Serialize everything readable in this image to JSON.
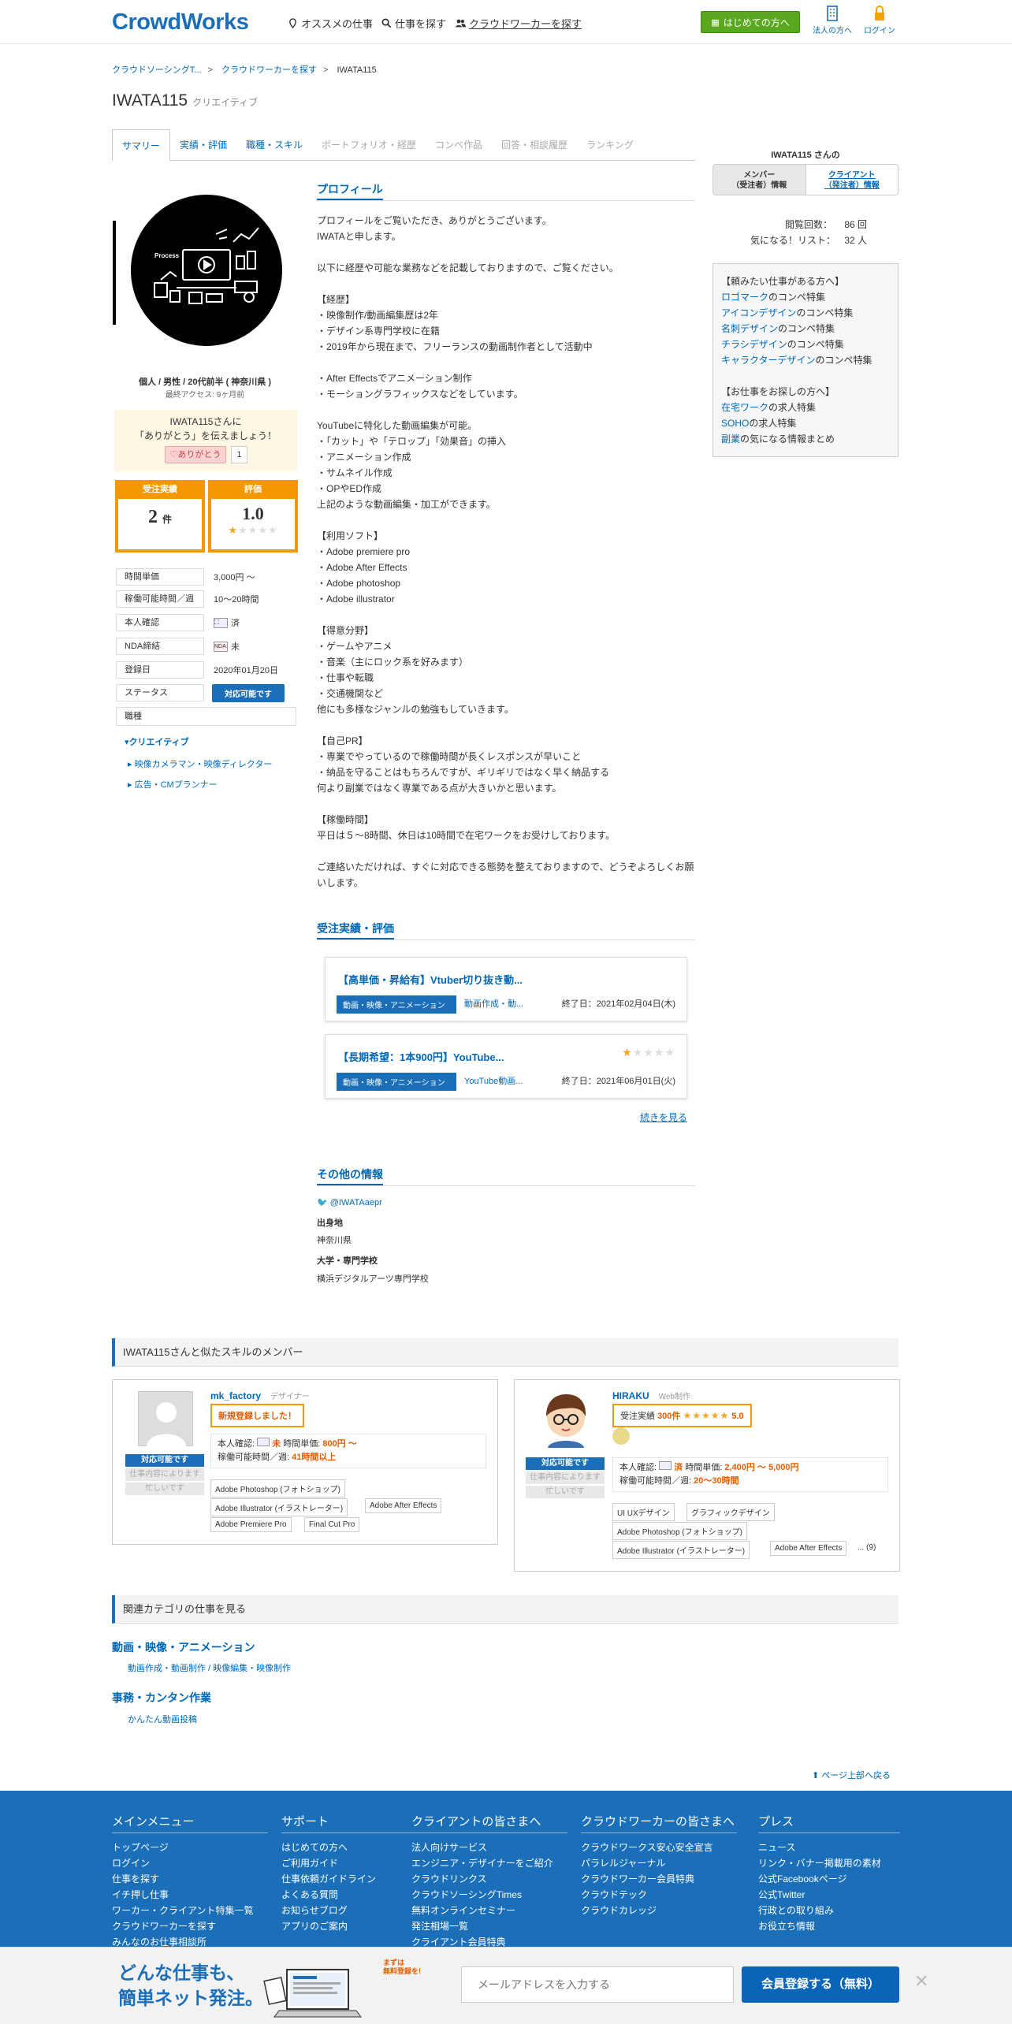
{
  "header": {
    "logo": "CrowdWorks",
    "nav": [
      "オススメの仕事",
      "仕事を探す",
      "クラウドワーカーを探す"
    ],
    "first_btn": "はじめての方へ",
    "corp": "法人の方へ",
    "login": "ログイン"
  },
  "breadcrumb": [
    "クラウドソーシングT...",
    "クラウドワーカーを探す",
    "IWATA115"
  ],
  "profile": {
    "name": "IWATA115",
    "category": "クリエイティブ",
    "tabs": [
      {
        "label": "サマリー",
        "state": "active"
      },
      {
        "label": "実績・評価",
        "state": "link"
      },
      {
        "label": "職種・スキル",
        "state": "link"
      },
      {
        "label": "ポートフォリオ・経歴",
        "state": "disabled"
      },
      {
        "label": "コンペ作品",
        "state": "disabled"
      },
      {
        "label": "回答・相談履歴",
        "state": "disabled"
      },
      {
        "label": "ランキング",
        "state": "disabled"
      }
    ],
    "identity": "個人 / 男性 / 20代前半 ( 神奈川県 )",
    "last_access": "最終アクセス: 9ヶ月前",
    "thanks_line1": "IWATA115さんに",
    "thanks_line2": "「ありがとう」を伝えましょう！",
    "thanks_btn": "ありがとう",
    "thanks_count": "1",
    "orders_label": "受注実績",
    "orders_value": "2",
    "orders_unit": "件",
    "rating_label": "評価",
    "rating_value": "1.0",
    "rating_stars": 1,
    "stats": [
      {
        "key": "時間単価",
        "value": "3,000円 〜"
      },
      {
        "key": "稼働可能時間／週",
        "value": "10〜20時間"
      },
      {
        "key": "本人確認",
        "value": "済"
      },
      {
        "key": "NDA締結",
        "value": "未"
      },
      {
        "key": "登録日",
        "value": "2020年01月20日"
      },
      {
        "key": "ステータス",
        "value": "対応可能です"
      }
    ],
    "job_label": "職種",
    "job_cat": "クリエイティブ",
    "job_subs": [
      "映像カメラマン・映像ディレクター",
      "広告・CMプランナー"
    ]
  },
  "main": {
    "profile_heading": "プロフィール",
    "profile_text": "プロフィールをご覧いただき、ありがとうございます。\nIWATAと申します。\n\n以下に経歴や可能な業務などを記載しておりますので、ご覧ください。\n\n【経歴】\n・映像制作/動画編集歴は2年\n・デザイン系専門学校に在籍\n・2019年から現在まで、フリーランスの動画制作者として活動中\n\n・After Effectsでアニメーション制作\n・モーショングラフィックスなどをしています。\n\nYouTubeに特化した動画編集が可能。\n・「カット」や「テロップ」「効果音」の挿入\n・アニメーション作成\n・サムネイル作成\n・OPやED作成\n上記のような動画編集・加工ができます。\n\n【利用ソフト】\n・Adobe premiere pro\n・Adobe After Effects\n・Adobe photoshop\n・Adobe illustrator\n\n【得意分野】\n・ゲームやアニメ\n・音楽（主にロック系を好みます）\n・仕事や転職\n・交通機関など\n他にも多様なジャンルの勉強もしていきます。\n\n【自己PR】\n・専業でやっているので稼働時間が長くレスポンスが早いこと\n・納品を守ることはもちろんですが、ギリギリではなく早く納品する\n何より副業ではなく専業である点が大きいかと思います。\n\n【稼働時間】\n平日は５～8時間、休日は10時間で在宅ワークをお受けしております。\n\nご連絡いただければ、すぐに対応できる態勢を整えておりますので、どうぞよろしくお願いします。",
    "works_heading": "受注実績・評価",
    "works": [
      {
        "title": "【高単価・昇給有】Vtuber切り抜き動...",
        "category": "動画・映像・アニメーション",
        "sub": "動画作成・動...",
        "end": "終了日：2021年02月04日(木)",
        "stars": null
      },
      {
        "title": "【長期希望：1本900円】YouTube...",
        "category": "動画・映像・アニメーション",
        "sub": "YouTube動画...",
        "end": "終了日：2021年06月01日(火)",
        "stars": 1
      }
    ],
    "more": "続きを見る",
    "other_heading": "その他の情報",
    "twitter": "@IWATAaepr",
    "birthplace_label": "出身地",
    "birthplace": "神奈川県",
    "school_label": "大学・専門学校",
    "school": "横浜デジタルアーツ専門学校"
  },
  "side": {
    "title": "IWATA115 さんの",
    "tab1": "メンバー\n（受注者）情報",
    "tab2": "クライアント\n（発注者）情報",
    "views_label": "閲覧回数：",
    "views": "86 回",
    "fav_label": "気になる！リスト：",
    "fav": "32 人",
    "box_h1": "【頼みたい仕事がある方へ】",
    "box_items1": [
      [
        "ロゴマーク",
        "のコンペ特集"
      ],
      [
        "アイコンデザイン",
        "のコンペ特集"
      ],
      [
        "名刺デザイン",
        "のコンペ特集"
      ],
      [
        "チラシデザイン",
        "のコンペ特集"
      ],
      [
        "キャラクターデザイン",
        "のコンペ特集"
      ]
    ],
    "box_h2": "【お仕事をお探しの方へ】",
    "box_items2": [
      [
        "在宅ワーク",
        "の求人特集"
      ],
      [
        "SOHO",
        "の求人特集"
      ],
      [
        "副業",
        "の気になる情報まとめ"
      ]
    ]
  },
  "similar": {
    "heading": "IWATA115さんと似たスキルのメンバー",
    "badge_ok": "対応可能です",
    "badge_dep": "仕事内容によります",
    "badge_busy": "忙しいです",
    "members": [
      {
        "name": "mk_factory",
        "role": "デザイナー",
        "highlight": "新規登録しました！",
        "verify": "未",
        "rate": "800円 〜",
        "hours": "41時間以上",
        "tags": [
          "Adobe Photoshop (フォトショップ)",
          "Adobe Illustrator (イラストレーター)",
          "Adobe After Effects",
          "Adobe Premiere Pro",
          "Final Cut Pro"
        ]
      },
      {
        "name": "HIRAKU",
        "role": "Web制作",
        "highlight_pre": "受注実績 ",
        "highlight_val": "300件",
        "rating": "5.0",
        "verify": "済",
        "rate": "2,400円 〜 5,000円",
        "hours": "20〜30時間",
        "tags": [
          "UI UXデザイン",
          "グラフィックデザイン",
          "Adobe Photoshop (フォトショップ)",
          "Adobe Illustrator (イラストレーター)",
          "Adobe After Effects"
        ],
        "more": "... (9)"
      }
    ],
    "verify_label": "本人確認:",
    "rate_label": "時間単価:",
    "hours_label": "稼働可能時間／週:"
  },
  "related": {
    "heading": "関連カテゴリの仕事を見る",
    "cats": [
      {
        "name": "動画・映像・アニメーション",
        "sub": "動画作成・動画制作 / 映像編集・映像制作"
      },
      {
        "name": "事務・カンタン作業",
        "sub": "かんたん動画投稿"
      }
    ]
  },
  "to_top": "ページ上部へ戻る",
  "footer": {
    "cols": [
      {
        "h": "メインメニュー",
        "items": [
          "トップページ",
          "ログイン",
          "仕事を探す",
          "イチ押し仕事",
          "ワーカー・クライアント特集一覧",
          "クラウドワーカーを探す",
          "みんなのお仕事相談所"
        ]
      },
      {
        "h": "サポート",
        "items": [
          "はじめての方へ",
          "ご利用ガイド",
          "仕事依頼ガイドライン",
          "よくある質問",
          "お知らせブログ",
          "アプリのご案内"
        ]
      },
      {
        "h": "クライアントの皆さまへ",
        "items": [
          "法人向けサービス",
          "エンジニア・デザイナーをご紹介",
          "クラウドリンクス",
          "クラウドソーシングTimes",
          "無料オンラインセミナー",
          "発注相場一覧",
          "クライアント会員特典"
        ]
      },
      {
        "h": "クラウドワーカーの皆さまへ",
        "items": [
          "クラウドワークス安心安全宣言",
          "パラレルジャーナル",
          "クラウドワーカー会員特典",
          "クラウドテック",
          "クラウドカレッジ"
        ]
      },
      {
        "h": "プレス",
        "items": [
          "ニュース",
          "リンク・バナー掲載用の素材",
          "公式Facebookページ",
          "公式Twitter",
          "行政との取り組み",
          "お役立ち情報"
        ]
      }
    ]
  },
  "banner": {
    "line1": "どんな仕事も、",
    "line2": "簡単ネット発注。",
    "bubble1": "まずは",
    "bubble2": "無料登録を!",
    "email_placeholder": "メールアドレスを入力する",
    "register": "会員登録する（無料）",
    "close": "✕"
  }
}
